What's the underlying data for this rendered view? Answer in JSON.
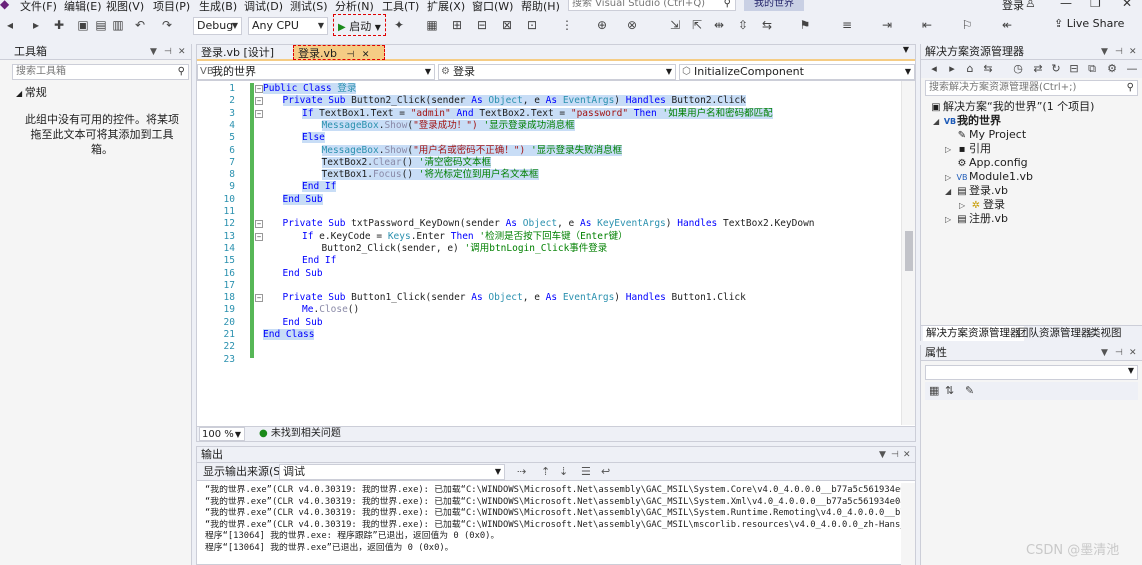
{
  "menu": {
    "items": [
      "文件(F)",
      "编辑(E)",
      "视图(V)",
      "项目(P)",
      "生成(B)",
      "调试(D)",
      "测试(S)",
      "分析(N)",
      "工具(T)",
      "扩展(X)",
      "窗口(W)",
      "帮助(H)"
    ],
    "search_placeholder": "搜索 Visual Studio (Ctrl+Q)",
    "solution_name": "我的世界",
    "user": "登录"
  },
  "toolbar": {
    "config": "Debug",
    "platform": "Any CPU",
    "start_label": "启动",
    "live_share": "Live Share"
  },
  "toolbox": {
    "title": "工具箱",
    "search_placeholder": "搜索工具箱",
    "group": "常规",
    "empty_message": "此组中没有可用的控件。将某项拖至此文本可将其添加到工具箱。"
  },
  "editor": {
    "tabs": [
      "登录.vb [设计]",
      "登录.vb"
    ],
    "nav_project": "我的世界",
    "nav_class": "登录",
    "nav_member": "InitializeComponent",
    "line_numbers": [
      "1",
      "2",
      "3",
      "4",
      "5",
      "6",
      "7",
      "8",
      "9",
      "10",
      "11",
      "12",
      "13",
      "14",
      "15",
      "16",
      "17",
      "18",
      "19",
      "20",
      "21",
      "22",
      "23"
    ],
    "zoom": "100 %",
    "issues": "未找到相关问题"
  },
  "output": {
    "title": "输出",
    "source_label": "显示输出来源(S):",
    "source_value": "调试",
    "lines": [
      "“我的世界.exe”(CLR v4.0.30319: 我的世界.exe): 已加载“C:\\WINDOWS\\Microsoft.Net\\assembly\\GAC_MSIL\\System.Core\\v4.0_4.0.0.0__b77a5c561934e089\\",
      "“我的世界.exe”(CLR v4.0.30319: 我的世界.exe): 已加载“C:\\WINDOWS\\Microsoft.Net\\assembly\\GAC_MSIL\\System.Xml\\v4.0_4.0.0.0__b77a5c561934e089\\S",
      "“我的世界.exe”(CLR v4.0.30319: 我的世界.exe): 已加载“C:\\WINDOWS\\Microsoft.Net\\assembly\\GAC_MSIL\\System.Runtime.Remoting\\v4.0_4.0.0.0__b77a5",
      "“我的世界.exe”(CLR v4.0.30319: 我的世界.exe): 已加载“C:\\WINDOWS\\Microsoft.Net\\assembly\\GAC_MSIL\\mscorlib.resources\\v4.0_4.0.0.0_zh-Hans_b77",
      "程序“[13064] 我的世界.exe: 程序跟踪”已退出，返回值为 0 (0x0)。",
      "程序“[13064] 我的世界.exe”已退出，返回值为 0 (0x0)。"
    ]
  },
  "solution_explorer": {
    "title": "解决方案资源管理器",
    "search_placeholder": "搜索解决方案资源管理器(Ctrl+;)",
    "items": [
      "解决方案“我的世界”(1 个项目)",
      "我的世界",
      "My Project",
      "引用",
      "App.config",
      "Module1.vb",
      "登录.vb",
      "登录",
      "注册.vb"
    ],
    "tabs": [
      "解决方案资源管理器",
      "团队资源管理器",
      "类视图"
    ]
  },
  "properties": {
    "title": "属性"
  },
  "watermark": "CSDN @墨清池"
}
